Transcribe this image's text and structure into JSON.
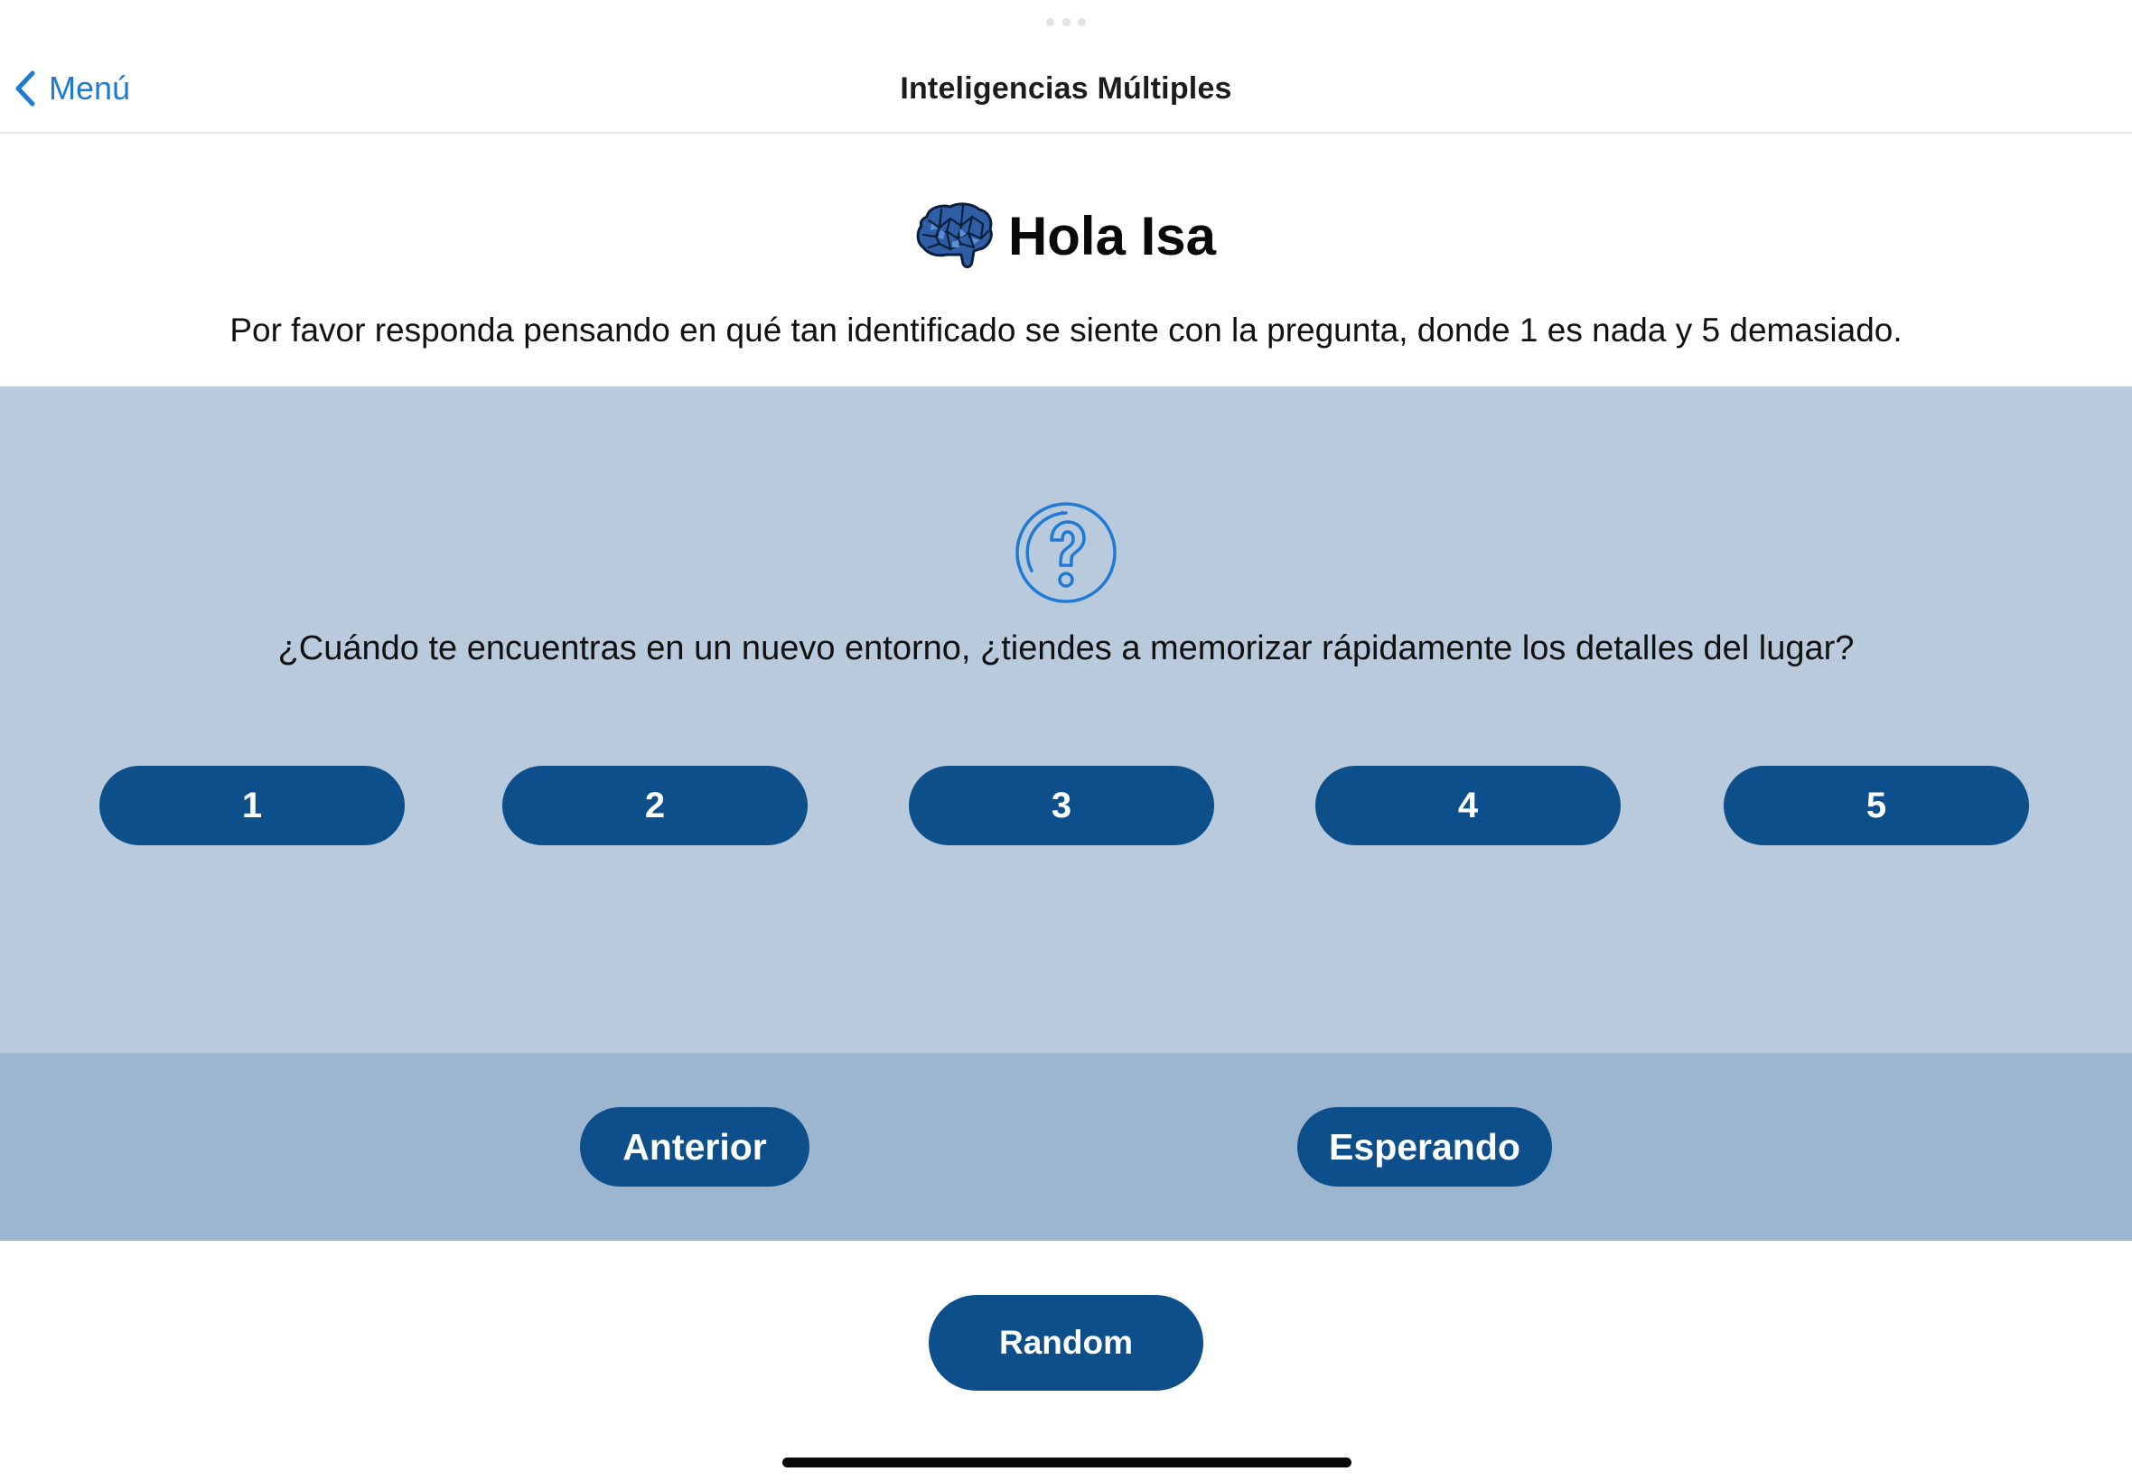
{
  "navbar": {
    "back_label": "Menú",
    "title": "Inteligencias Múltiples"
  },
  "header": {
    "greeting": "Hola Isa",
    "instructions": "Por favor responda pensando en qué tan identificado se siente con la pregunta, donde 1 es nada y 5 demasiado."
  },
  "question": {
    "text": "¿Cuándo te encuentras en un nuevo entorno, ¿tiendes a memorizar rápidamente los detalles del lugar?",
    "options": [
      "1",
      "2",
      "3",
      "4",
      "5"
    ]
  },
  "navigation": {
    "previous_label": "Anterior",
    "next_label": "Esperando"
  },
  "random_label": "Random",
  "icons": {
    "back": "chevron-left-icon",
    "brain": "brain-icon",
    "question": "question-circle-icon"
  },
  "colors": {
    "accent_link": "#1f7ad6",
    "button": "#0d4f8b",
    "question_panel": "#b8cadb",
    "nav_panel": "#9db6d0"
  }
}
